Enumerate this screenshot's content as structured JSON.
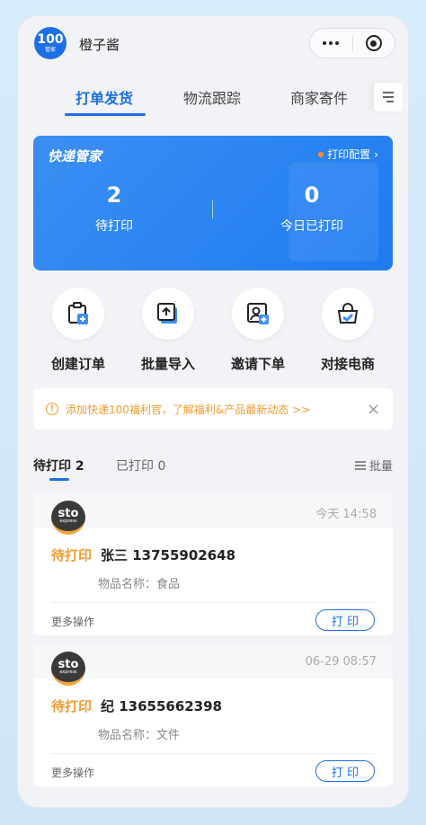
{
  "header": {
    "logo_text": "100",
    "logo_sub": "管家",
    "shop_name": "橙子酱"
  },
  "tabs": [
    {
      "label": "打单发货",
      "active": true
    },
    {
      "label": "物流跟踪",
      "active": false
    },
    {
      "label": "商家寄件",
      "active": false
    }
  ],
  "summary": {
    "brand": "快递管家",
    "print_config": "打印配置",
    "pending_count": "2",
    "pending_label": "待打印",
    "printed_today_count": "0",
    "printed_today_label": "今日已打印"
  },
  "actions": [
    {
      "label": "创建订单",
      "icon": "create-order-icon"
    },
    {
      "label": "批量导入",
      "icon": "batch-import-icon"
    },
    {
      "label": "邀请下单",
      "icon": "invite-order-icon"
    },
    {
      "label": "对接电商",
      "icon": "ecommerce-icon"
    }
  ],
  "notice": {
    "text": "添加快递100福利官，了解福利&产品最新动态 >>"
  },
  "order_tabs": {
    "pending": "待打印 2",
    "printed": "已打印 0",
    "batch": "批量"
  },
  "orders": [
    {
      "carrier_logo": "sto",
      "carrier_sub": "express",
      "time": "今天 14:58",
      "status": "待打印",
      "name_phone": "张三  13755902648",
      "item": "物品名称：食品",
      "more": "更多操作",
      "print_label": "打 印"
    },
    {
      "carrier_logo": "sto",
      "carrier_sub": "express",
      "time": "06-29 08:57",
      "status": "待打印",
      "name_phone": "纪  13655662398",
      "item": "物品名称：文件",
      "more": "更多操作",
      "print_label": "打 印"
    }
  ],
  "colors": {
    "accent": "#1d6fe6",
    "warning": "#f39b2c"
  }
}
